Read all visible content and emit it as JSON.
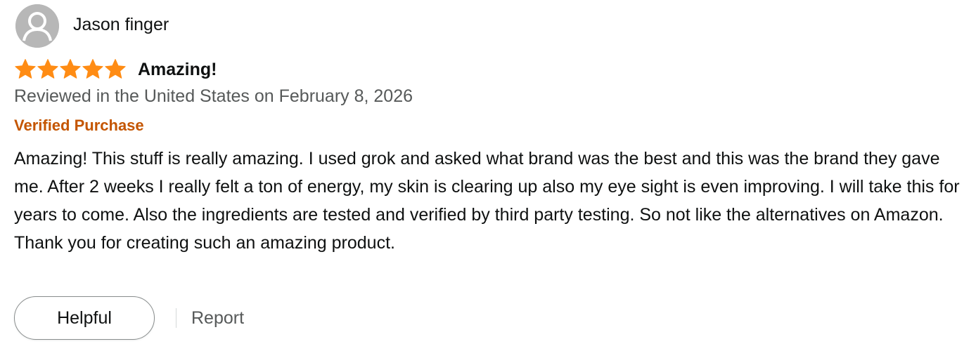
{
  "reviewer": {
    "name": "Jason finger",
    "avatar_icon": "default-user-avatar-icon"
  },
  "rating": {
    "value": 5,
    "max": 5,
    "star_color": "#ff8c14"
  },
  "review": {
    "title": "Amazing!",
    "date_line": "Reviewed in the United States on February 8, 2026",
    "verified_label": "Verified Purchase",
    "body_paragraphs": [
      "Amazing! This stuff is really amazing. I used grok and asked what brand was the best and this was the brand they gave me. After 2 weeks I really felt a ton of energy, my skin is clearing up also my eye sight is even improving. I will take this for years to come. Also the ingredients are tested and verified by third party testing. So not like the alternatives on Amazon.",
      "Thank you for creating such an amazing product."
    ]
  },
  "actions": {
    "helpful_label": "Helpful",
    "report_label": "Report"
  },
  "colors": {
    "verified": "#c45500",
    "secondary_text": "#565959",
    "primary_text": "#0f1111",
    "avatar_bg": "#b7b7b7"
  }
}
